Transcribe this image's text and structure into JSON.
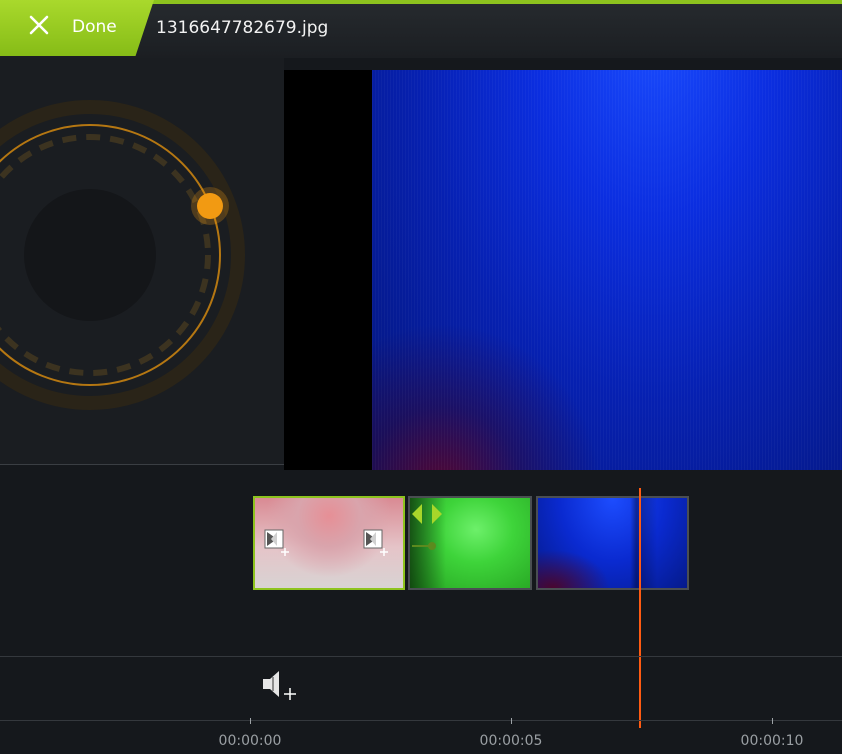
{
  "header": {
    "done_label": "Done",
    "file_title": "1316647782679.jpg"
  },
  "colors": {
    "accent": "#8dc31e",
    "playhead": "#ff5b12",
    "jog_knob": "#f29a12"
  },
  "timeline": {
    "clips": [
      {
        "name": "pink-clip",
        "selected": true
      },
      {
        "name": "green-clip",
        "selected": false
      },
      {
        "name": "blue-clip",
        "selected": false
      }
    ],
    "ruler": [
      "00:00:00",
      "00:00:05",
      "00:00:10"
    ]
  },
  "icons": [
    "close-icon",
    "jog-wheel",
    "add-transition-icon",
    "trim-handles-icon",
    "add-audio-icon"
  ]
}
